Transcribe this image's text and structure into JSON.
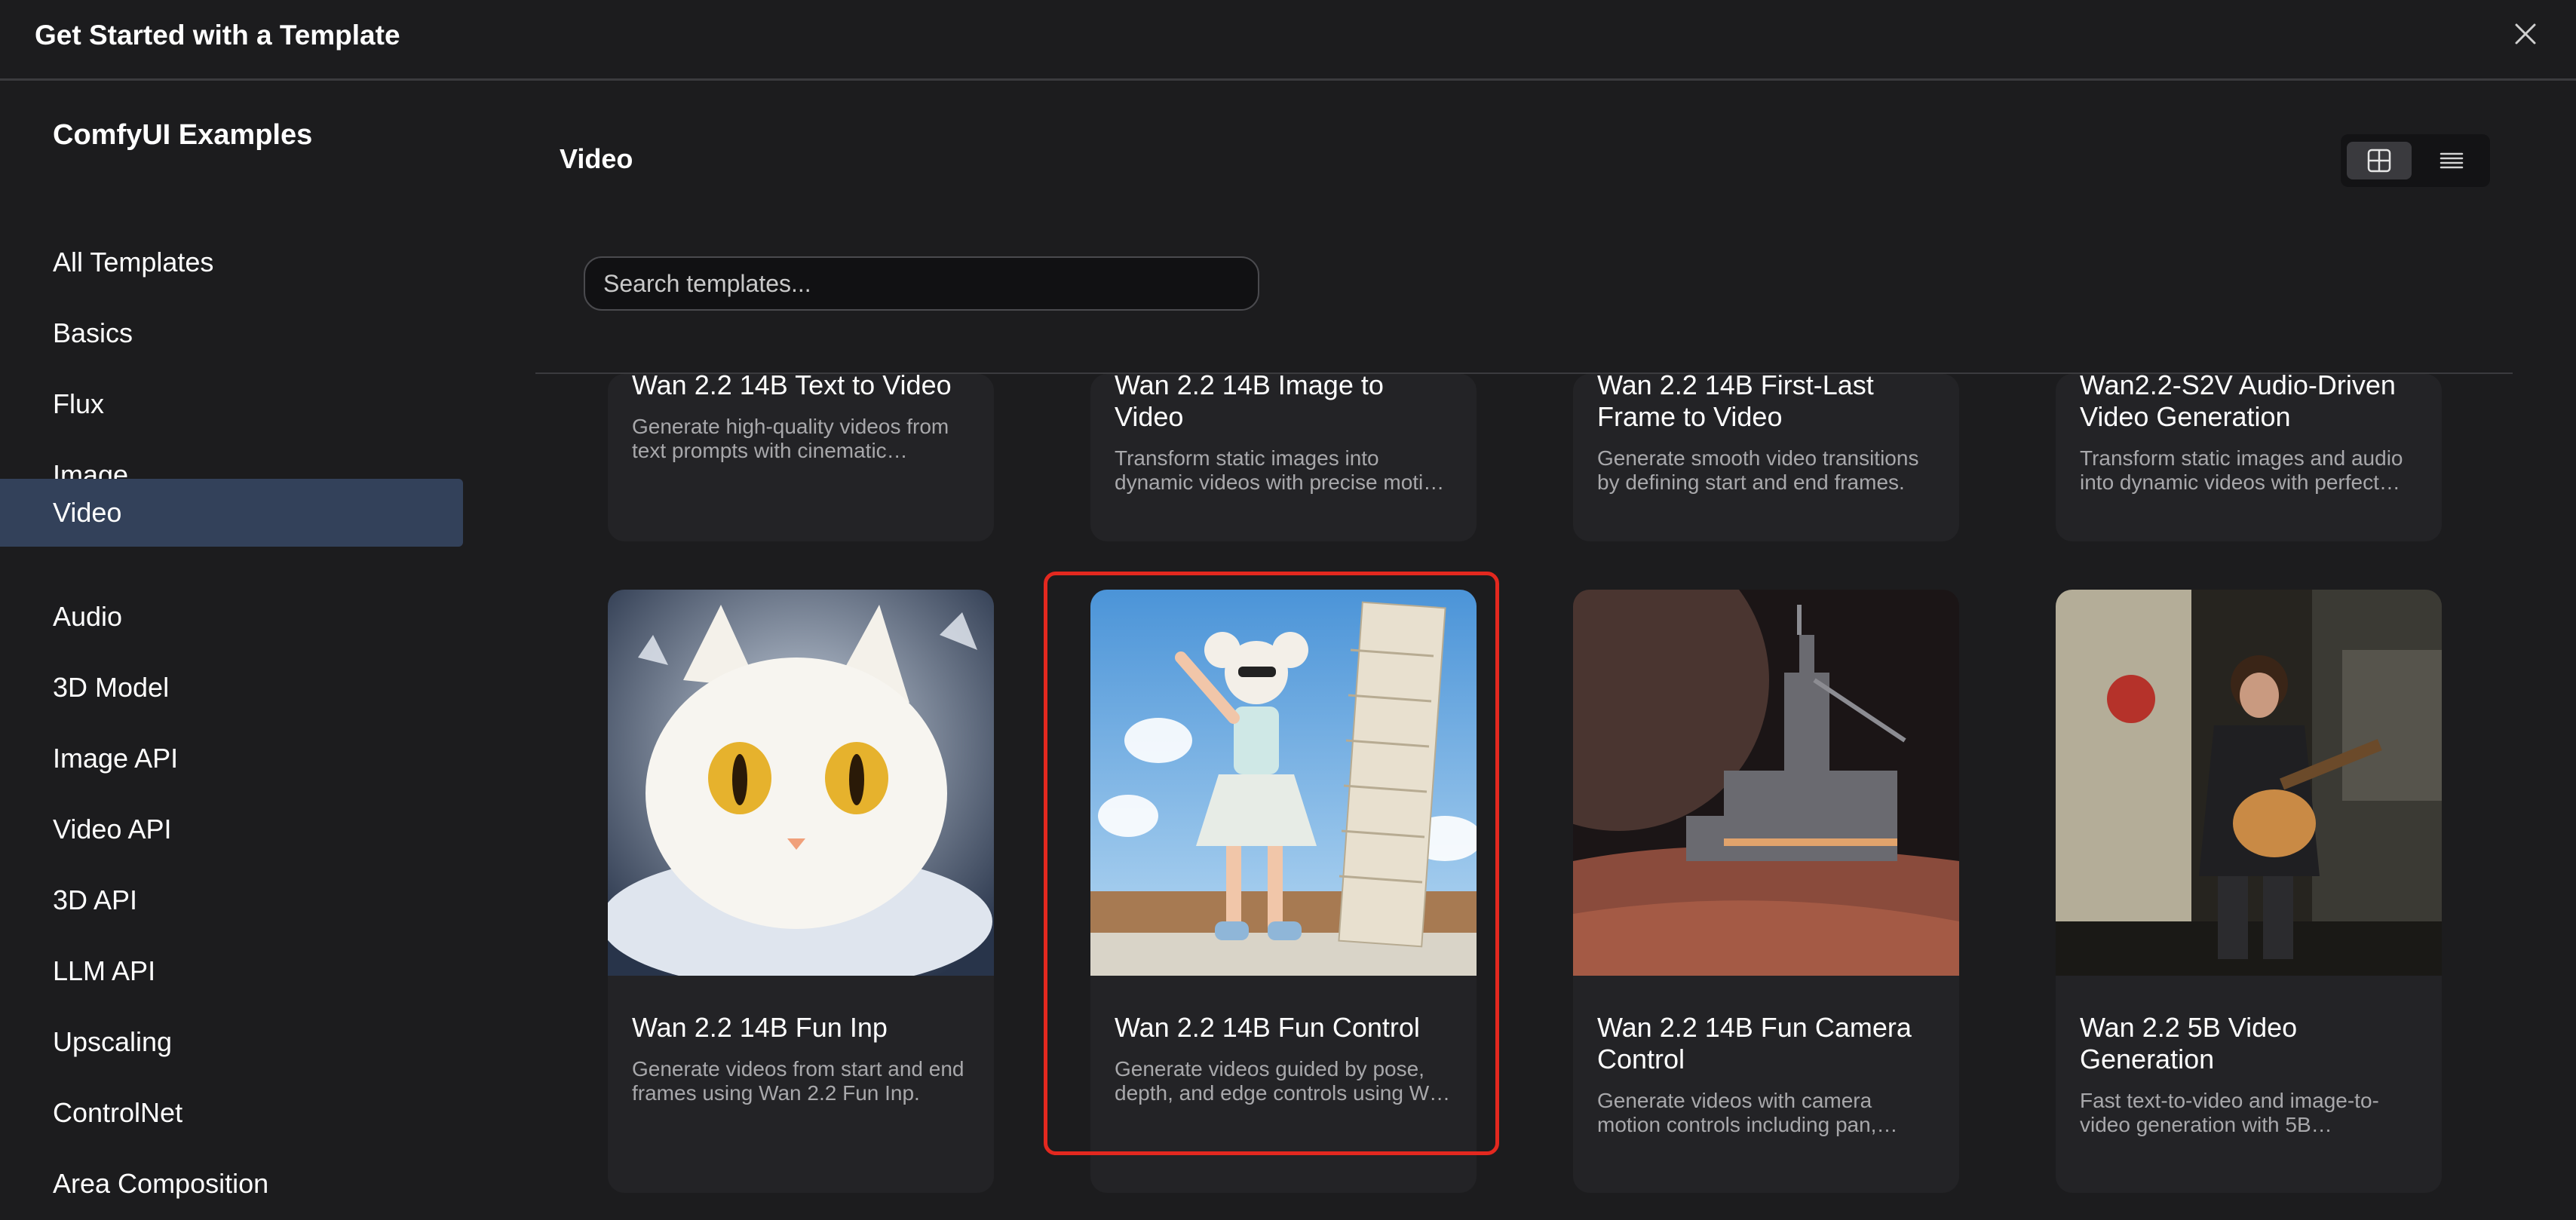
{
  "dialog": {
    "title": "Get Started with a Template"
  },
  "sidebar": {
    "title": "ComfyUI Examples",
    "items": [
      {
        "label": "All Templates"
      },
      {
        "label": "Basics"
      },
      {
        "label": "Flux"
      },
      {
        "label": "Image"
      },
      {
        "label": "Video",
        "active": true
      },
      {
        "label": "Audio"
      },
      {
        "label": "3D Model"
      },
      {
        "label": "Image API"
      },
      {
        "label": "Video API"
      },
      {
        "label": "3D API"
      },
      {
        "label": "LLM API"
      },
      {
        "label": "Upscaling"
      },
      {
        "label": "ControlNet"
      },
      {
        "label": "Area Composition"
      }
    ]
  },
  "main": {
    "heading": "Video",
    "search_placeholder": "Search templates...",
    "view_modes": {
      "grid": "grid-icon",
      "list": "list-icon",
      "selected": "grid"
    }
  },
  "templates": [
    {
      "title": "Wan 2.2 14B Text to Video",
      "desc": "Generate high-quality videos from text prompts with cinematic…"
    },
    {
      "title": "Wan 2.2 14B Image to Video",
      "desc": "Transform static images into dynamic videos with precise moti…"
    },
    {
      "title": "Wan 2.2 14B First-Last Frame to Video",
      "desc": "Generate smooth video transitions by defining start and end frames."
    },
    {
      "title": "Wan2.2-S2V Audio-Driven Video Generation",
      "desc": "Transform static images and audio into dynamic videos with perfect…"
    },
    {
      "title": "Wan 2.2 14B Fun Inp",
      "desc": "Generate videos from start and end frames using Wan 2.2 Fun Inp."
    },
    {
      "title": "Wan 2.2 14B Fun Control",
      "desc": "Generate videos guided by pose, depth, and edge controls using W…",
      "highlighted": true
    },
    {
      "title": "Wan 2.2 14B Fun Camera Control",
      "desc": "Generate videos with camera motion controls including pan,…"
    },
    {
      "title": "Wan 2.2 5B Video Generation",
      "desc": "Fast text-to-video and image-to-video generation with 5B…"
    }
  ],
  "colors": {
    "accent_active": "#33415a",
    "highlight_border": "#e3281f",
    "background": "#1c1c1e"
  }
}
